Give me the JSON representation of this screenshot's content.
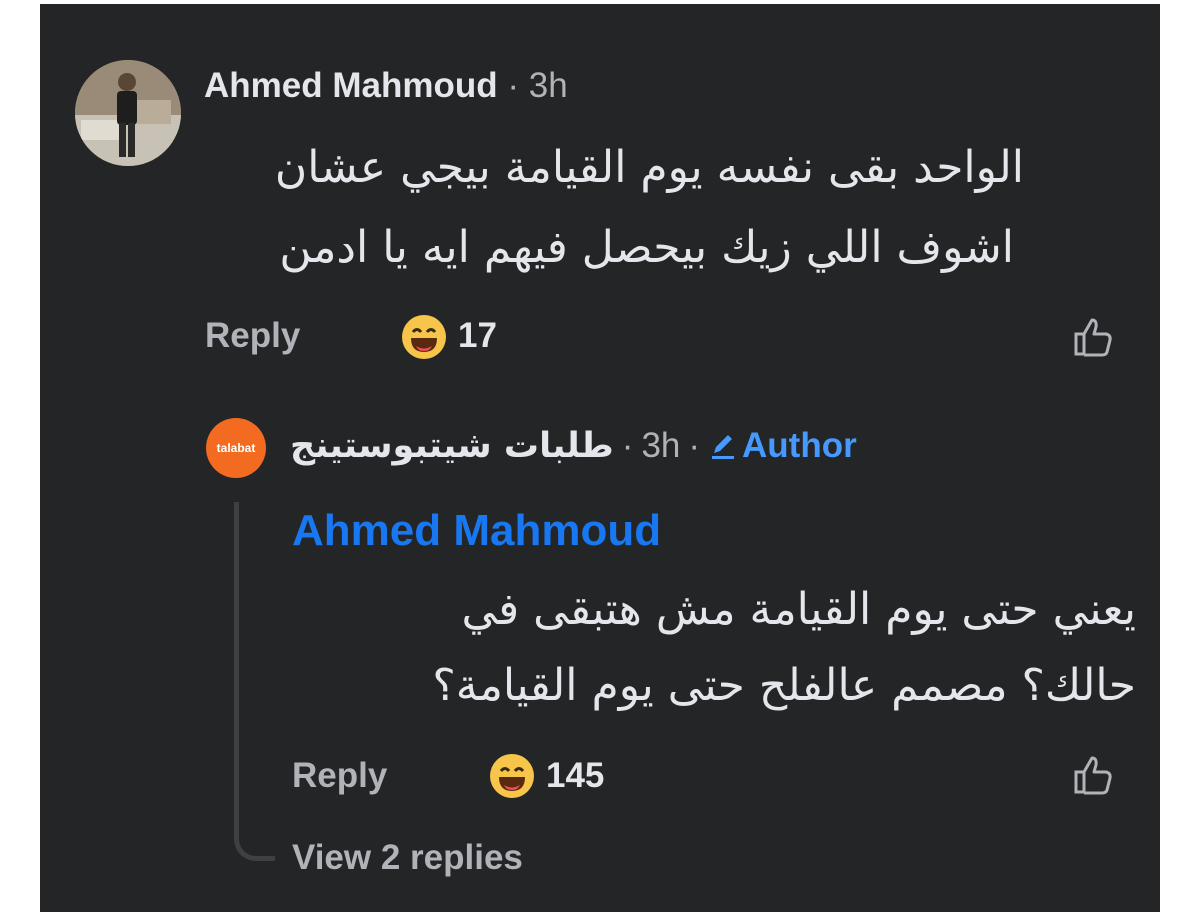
{
  "comment": {
    "author": "Ahmed Mahmoud",
    "separator": "·",
    "time": "3h",
    "text_line1": "الواحد بقى نفسه يوم القيامة بيجي عشان",
    "text_line2": "اشوف اللي زيك بيحصل فيهم ايه يا ادمن",
    "reply_label": "Reply",
    "reaction_icon": "haha-emoji-icon",
    "reaction_count": "17"
  },
  "reply": {
    "avatar_text": "talabat",
    "page_name": "طلبات شيتبوستينج",
    "separator": "·",
    "time": "3h",
    "badge_label": "Author",
    "mention": "Ahmed Mahmoud",
    "text_line1": "يعني حتى يوم القيامة مش هتبقى في",
    "text_line2": "حالك؟ مصمم عالفلح حتى يوم القيامة؟",
    "reply_label": "Reply",
    "reaction_icon": "haha-emoji-icon",
    "reaction_count": "145",
    "view_replies": "View 2 replies"
  },
  "colors": {
    "background": "#242526",
    "text": "#e4e6eb",
    "secondary": "#b0b3b8",
    "link_blue": "#1877f2",
    "page_avatar": "#f26b21"
  }
}
